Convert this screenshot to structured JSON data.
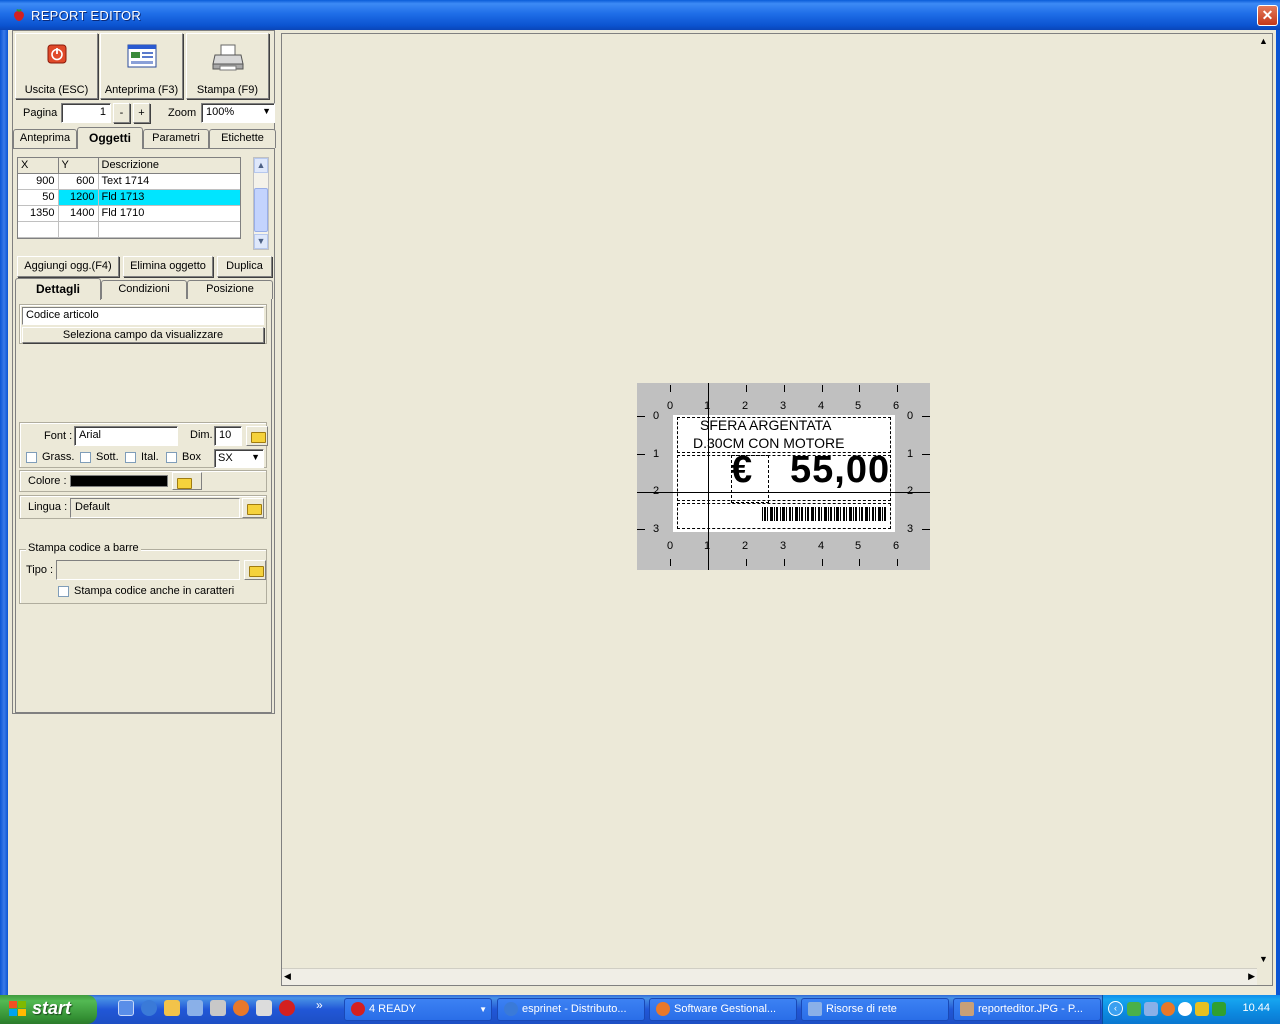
{
  "window": {
    "title": "REPORT EDITOR",
    "close": "✕"
  },
  "toolbar": {
    "exit_label": "Uscita (ESC)",
    "preview_label": "Anteprima (F3)",
    "print_label": "Stampa (F9)"
  },
  "pager": {
    "page_label": "Pagina",
    "page_value": "1",
    "minus": "-",
    "plus": "+",
    "zoom_label": "Zoom",
    "zoom_value": "100%"
  },
  "tabs_top": [
    "Anteprima",
    "Oggetti",
    "Parametri",
    "Etichette"
  ],
  "objects_table": {
    "headers": [
      "X",
      "Y",
      "Descrizione"
    ],
    "rows": [
      {
        "x": "900",
        "y": "600",
        "desc": "Text 1714"
      },
      {
        "x": "50",
        "y": "1200",
        "desc": "Fld 1713"
      },
      {
        "x": "1350",
        "y": "1400",
        "desc": "Fld 1710"
      }
    ]
  },
  "object_actions": {
    "add": "Aggiungi ogg.(F4)",
    "delete": "Elimina oggetto",
    "duplicate": "Duplica"
  },
  "tabs_detail": [
    "Dettagli",
    "Condizioni",
    "Posizione"
  ],
  "details": {
    "field_value": "Codice articolo",
    "select_field_button": "Seleziona campo da visualizzare",
    "font_label": "Font :",
    "font_value": "Arial",
    "size_label": "Dim.",
    "size_value": "10",
    "bold_label": "Grass.",
    "underline_label": "Sott.",
    "italic_label": "Ital.",
    "box_label": "Box",
    "align_value": "SX",
    "color_label": "Colore :",
    "color_value": "#000000",
    "language_label": "Lingua :",
    "language_value": "Default",
    "barcode_group": "Stampa codice a barre",
    "type_label": "Tipo :",
    "barcode_chars_label": "Stampa codice anche in caratteri"
  },
  "label_preview": {
    "ruler_top": [
      "0",
      "1",
      "2",
      "3",
      "4",
      "5",
      "6"
    ],
    "ruler_side": [
      "0",
      "1",
      "2",
      "3"
    ],
    "line1": "SFERA ARGENTATA",
    "line2": "D.30CM CON MOTORE",
    "currency": "€",
    "price": "55,00"
  },
  "taskbar": {
    "start": "start",
    "tasks": [
      "4 READY",
      "esprinet - Distributo...",
      "Software Gestional...",
      "Risorse di rete",
      "reporteditor.JPG - P..."
    ],
    "clock": "10.44"
  }
}
